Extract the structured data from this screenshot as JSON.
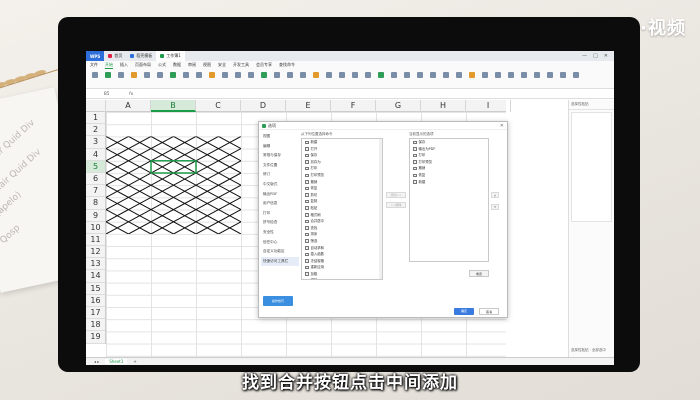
{
  "watermark": "天奇·视频",
  "caption": "找到合并按钮点击中间添加",
  "notebook_lines": [
    "Blair Quid Div",
    "Blair Quid Div",
    "(apelo)",
    "Qosp"
  ],
  "titlebar": {
    "logo": "WPS",
    "tabs": [
      "首页",
      "稻壳模板",
      "工作簿1"
    ],
    "window_controls": [
      "—",
      "□",
      "✕"
    ]
  },
  "ribbon": {
    "menus": [
      "文件",
      "开始",
      "插入",
      "页面布局",
      "公式",
      "数据",
      "审阅",
      "视图",
      "安全",
      "开发工具",
      "会员专享",
      "查找命令"
    ],
    "active_menu": "开始"
  },
  "formula_bar": {
    "cell_ref": "B5",
    "fx": "fx"
  },
  "grid": {
    "columns": [
      "A",
      "B",
      "C",
      "D",
      "E",
      "F",
      "G",
      "H",
      "I"
    ],
    "rows": [
      "1",
      "2",
      "3",
      "4",
      "5",
      "6",
      "7",
      "8",
      "9",
      "10",
      "11",
      "12",
      "13",
      "14",
      "15",
      "16",
      "17",
      "18",
      "19"
    ],
    "selected_column": "B",
    "selected_row": "5"
  },
  "sheet_tab": "Sheet1",
  "right_pane": {
    "header": "选择性粘贴",
    "footer": "选择性粘贴 · 全部选中"
  },
  "dialog": {
    "title": "选项",
    "close": "✕",
    "nav": [
      "视图",
      "编辑",
      "常规与保存",
      "文件位置",
      "修订",
      "中文版式",
      "输出PDF",
      "用户信息",
      "打印",
      "拼写检查",
      "安全性",
      "信任中心",
      "自定义功能区",
      "快速访问工具栏"
    ],
    "active_nav": "快速访问工具栏",
    "left_label": "从下列位置选择命令",
    "left_items": [
      "新建",
      "打开",
      "保存",
      "另存为",
      "打印",
      "打印预览",
      "撤销",
      "恢复",
      "剪切",
      "复制",
      "粘贴",
      "格式刷",
      "合并居中",
      "查找",
      "排序",
      "筛选",
      "自动求和",
      "插入函数",
      "冻结窗格",
      "重新应用",
      "加粗",
      "倾斜",
      "下划线",
      "字体颜色",
      "填充颜色",
      "边框",
      "左对齐"
    ],
    "mid_buttons": [
      "添加>>",
      "<<删除"
    ],
    "right_label": "当前显示的选项",
    "right_items": [
      "保存",
      "输出为PDF",
      "打印",
      "打印预览",
      "撤销",
      "恢复",
      "新建"
    ],
    "arrows": [
      "▲",
      "▼"
    ],
    "reset": "重置",
    "tips": "操作技巧",
    "ok": "确定",
    "cancel": "取消"
  }
}
